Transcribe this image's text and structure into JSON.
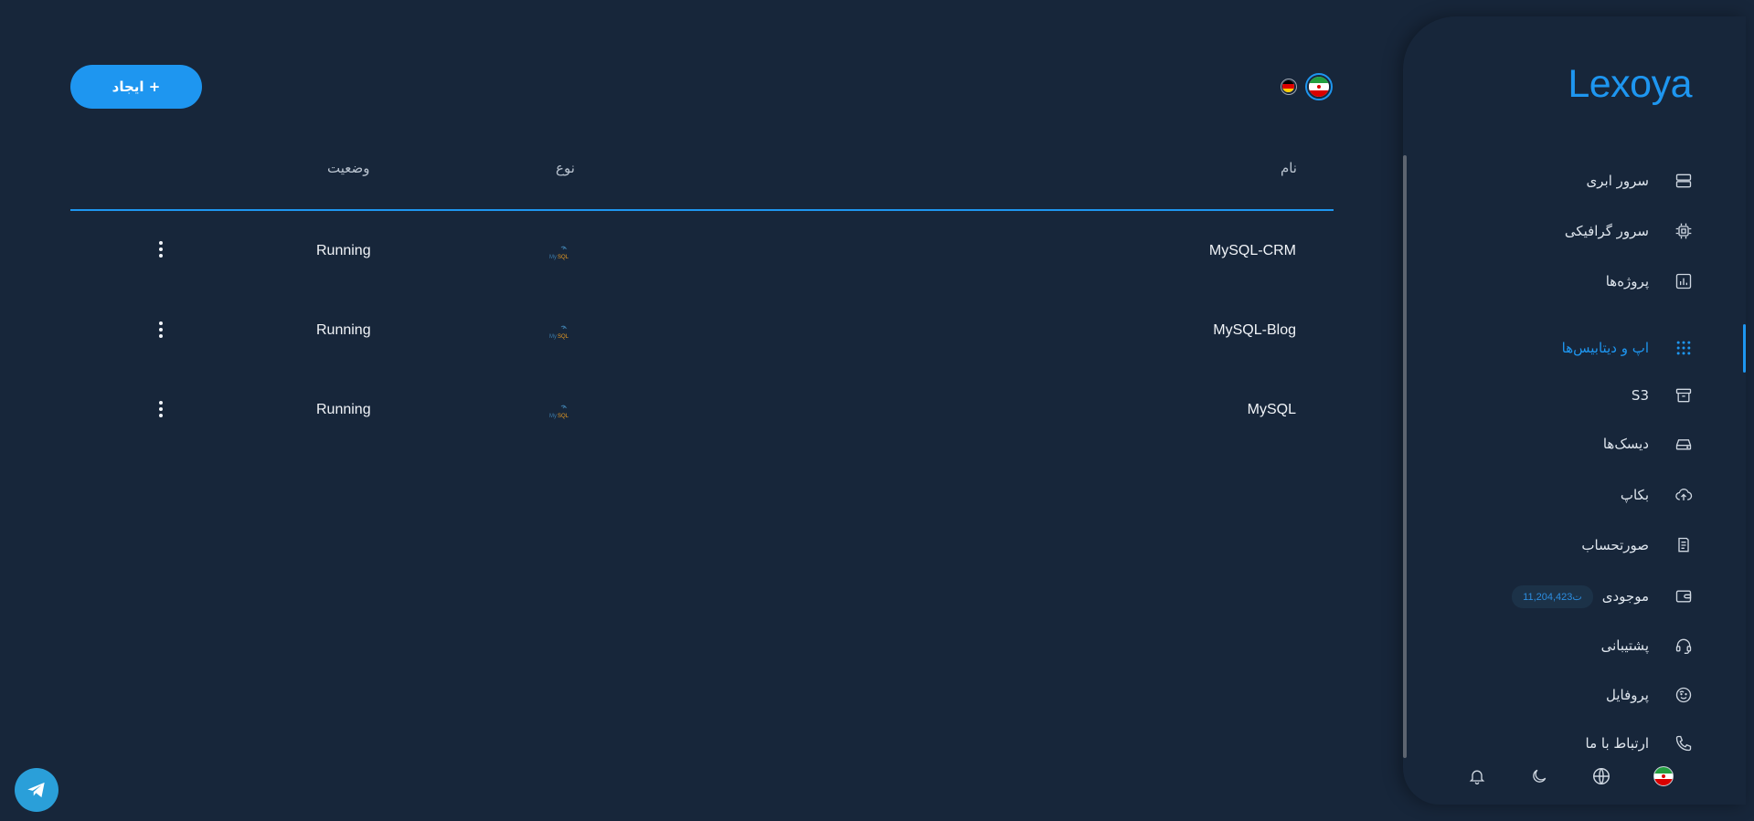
{
  "brand": {
    "logo": "Lexoya"
  },
  "header": {
    "create_label": "+ ایجاد",
    "languages": [
      "fa",
      "de"
    ]
  },
  "table": {
    "columns": {
      "name": "نام",
      "type": "نوع",
      "status": "وضعیت"
    },
    "rows": [
      {
        "name": "MySQL-CRM",
        "type_icon": "mysql-logo",
        "status": "Running"
      },
      {
        "name": "MySQL-Blog",
        "type_icon": "mysql-logo",
        "status": "Running"
      },
      {
        "name": "MySQL",
        "type_icon": "mysql-logo",
        "status": "Running"
      }
    ]
  },
  "sidebar": {
    "items": [
      {
        "label": "سرور ابری",
        "icon": "server-icon"
      },
      {
        "label": "سرور گرافیکی",
        "icon": "cpu-icon"
      },
      {
        "label": "پروژه‌ها",
        "icon": "chart-icon"
      },
      {
        "label": "اپ و دیتابیس‌ها",
        "icon": "grid-icon",
        "active": true
      },
      {
        "label": "S3",
        "icon": "archive-icon"
      },
      {
        "label": "دیسک‌ها",
        "icon": "disk-icon"
      },
      {
        "label": "بکاپ",
        "icon": "cloud-upload-icon"
      },
      {
        "label": "صورتحساب",
        "icon": "receipt-icon"
      },
      {
        "label": "موجودی",
        "icon": "wallet-icon",
        "badge": "11,204,423ت"
      },
      {
        "label": "پشتیبانی",
        "icon": "headset-icon"
      },
      {
        "label": "پروفایل",
        "icon": "face-icon"
      },
      {
        "label": "ارتباط با ما",
        "icon": "phone-icon"
      }
    ],
    "footer_icons": [
      "bell-icon",
      "moon-icon",
      "globe-icon",
      "flag-fa-icon"
    ]
  },
  "colors": {
    "background": "#17263a",
    "accent": "#1e96f0",
    "text": "#dfe6ee"
  }
}
